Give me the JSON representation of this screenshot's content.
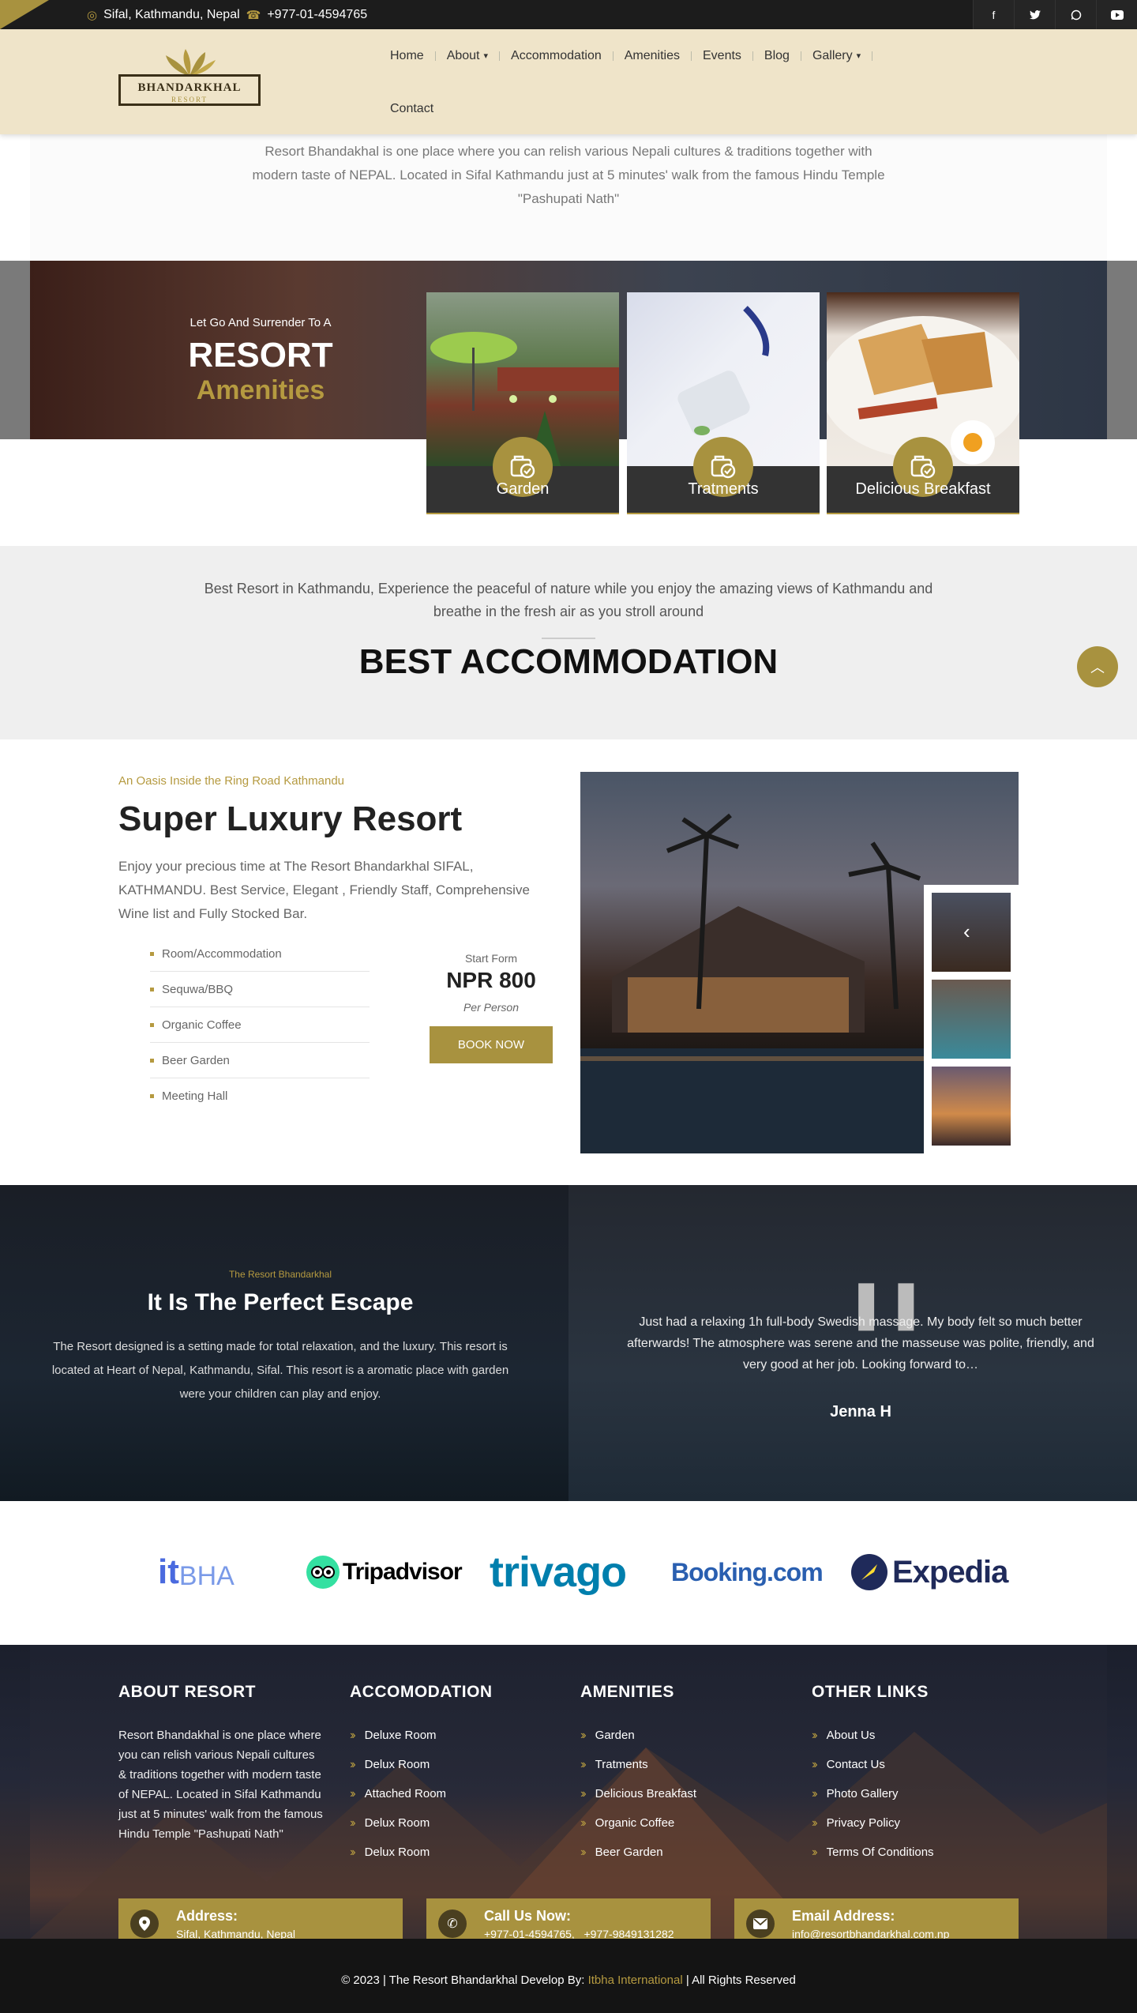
{
  "topbar": {
    "address": "Sifal, Kathmandu, Nepal",
    "phone": "+977-01-4594765",
    "socials": [
      "facebook-icon",
      "twitter-icon",
      "whatsapp-icon",
      "youtube-icon"
    ]
  },
  "header": {
    "logo_name": "BHANDARKHAL",
    "logo_sub": "RESORT",
    "nav": [
      "Home",
      "About",
      "Accommodation",
      "Amenities",
      "Events",
      "Blog",
      "Gallery",
      "Contact"
    ]
  },
  "intro": {
    "text": "Resort Bhandakhal is one place where you can relish various Nepali cultures & traditions together with modern taste of NEPAL. Located in Sifal Kathmandu just at 5 minutes' walk from the famous Hindu Temple \"Pashupati Nath\""
  },
  "amenities": {
    "pre": "Let Go And Surrender To A",
    "title": "RESORT",
    "subtitle": "Amenities",
    "cards": [
      {
        "label": "Garden"
      },
      {
        "label": "Tratments"
      },
      {
        "label": "Delicious Breakfast"
      }
    ]
  },
  "best": {
    "text": "Best Resort in Kathmandu, Experience the peaceful of nature while you enjoy the amazing views of Kathmandu and breathe in the fresh air as you stroll around",
    "title": "BEST ACCOMMODATION"
  },
  "luxury": {
    "pre": "An Oasis Inside the Ring Road Kathmandu",
    "title": "Super Luxury Resort",
    "desc": "Enjoy your precious time at The Resort Bhandarkhal SIFAL, KATHMANDU. Best Service, Elegant , Friendly Staff, Comprehensive Wine list and Fully Stocked Bar.",
    "list": [
      "Room/Accommodation",
      "Sequwa/BBQ",
      "Organic Coffee",
      "Beer Garden",
      "Meeting Hall"
    ],
    "price_from": "Start Form",
    "price": "NPR 800",
    "price_per": "Per Person",
    "book": "BOOK NOW"
  },
  "escape": {
    "pre": "The Resort Bhandarkhal",
    "title": "It Is The Perfect Escape",
    "desc": "The Resort designed is a setting made for total relaxation, and the luxury. This resort is located at Heart of Nepal, Kathmandu, Sifal. This resort is a aromatic place with garden were your children can play and enjoy.",
    "review": "Just had a relaxing 1h full-body Swedish massage. My body felt so much better afterwards! The atmosphere was serene and the masseuse was polite, friendly, and very good at her job. Looking forward to…",
    "reviewer": "Jenna H"
  },
  "partners": {
    "itbha": "it",
    "itbha2": "BHA",
    "tripadvisor": "Tripadvisor",
    "trivago": "trivago",
    "booking": "Booking.com",
    "expedia": "Expedia"
  },
  "footer": {
    "about_title": "ABOUT RESORT",
    "about_text": "Resort Bhandakhal is one place where you can relish various Nepali cultures & traditions together with modern taste of NEPAL. Located in Sifal Kathmandu just at 5 minutes' walk from the famous Hindu Temple \"Pashupati Nath\"",
    "accom_title": "ACCOMODATION",
    "accom": [
      "Deluxe Room",
      "Delux Room",
      "Attached Room",
      "Delux Room",
      "Delux Room"
    ],
    "amen_title": "AMENITIES",
    "amen": [
      "Garden",
      "Tratments",
      "Delicious Breakfast",
      "Organic Coffee",
      "Beer Garden"
    ],
    "links_title": "OTHER LINKS",
    "links": [
      "About Us",
      "Contact Us",
      "Photo Gallery",
      "Privacy Policy",
      "Terms Of Conditions"
    ],
    "address_label": "Address:",
    "address": "Sifal, Kathmandu, Nepal",
    "call_label": "Call Us Now:",
    "call": "+977-01-4594765,   +977-9849131282",
    "email_label": "Email Address:",
    "email": "info@resortbhandarkhal.com.np",
    "copy_pre": "© 2023 | The Resort Bhandarkhal Develop By:",
    "copy_link": "Itbha International",
    "copy_post": "| All Rights Reserved"
  },
  "colors": {
    "gold": "#a8923f",
    "cream": "#efe4c9",
    "dark": "#1c1c1c"
  }
}
